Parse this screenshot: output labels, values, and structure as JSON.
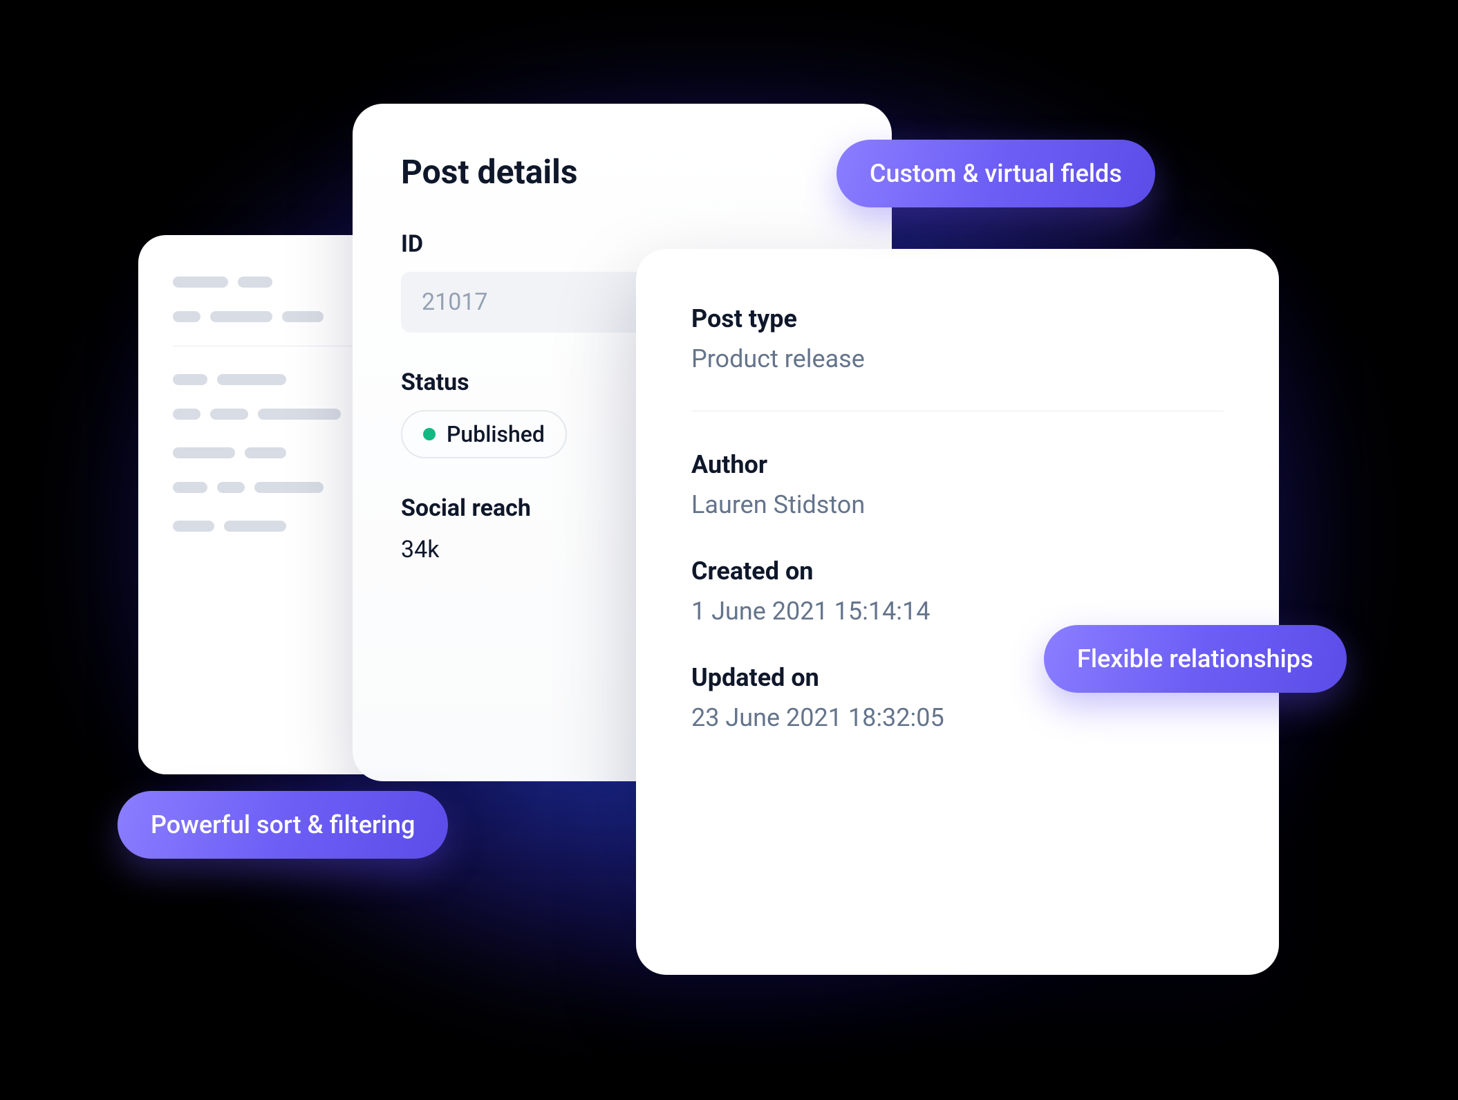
{
  "postDetails": {
    "title": "Post details",
    "id": {
      "label": "ID",
      "value": "21017"
    },
    "status": {
      "label": "Status",
      "value": "Published",
      "dotColor": "#10b981"
    },
    "socialReach": {
      "label": "Social reach",
      "value": "34k"
    }
  },
  "postMeta": {
    "postType": {
      "label": "Post type",
      "value": "Product release"
    },
    "author": {
      "label": "Author",
      "value": "Lauren Stidston"
    },
    "createdOn": {
      "label": "Created on",
      "value": "1 June 2021 15:14:14"
    },
    "updatedOn": {
      "label": "Updated on",
      "value": "23 June 2021 18:32:05"
    }
  },
  "features": {
    "custom": "Custom & virtual fields",
    "flexible": "Flexible relationships",
    "sort": "Powerful sort & filtering"
  }
}
